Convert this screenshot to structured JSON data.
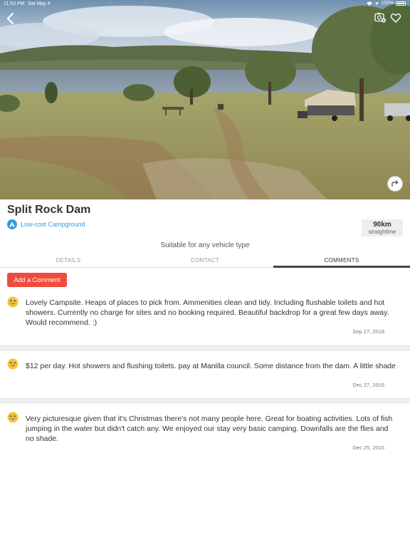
{
  "status_bar": {
    "time": "11:53 PM",
    "date": "Sat May 4",
    "battery": "100%"
  },
  "place": {
    "title": "Split Rock Dam",
    "type_label": "Low-cost Campground",
    "distance_value": "90km",
    "distance_unit": "straightline",
    "suitability": "Suitable for any vehicle type"
  },
  "tabs": [
    {
      "label": "DETAILS",
      "active": false
    },
    {
      "label": "CONTACT",
      "active": false
    },
    {
      "label": "COMMENTS",
      "active": true
    }
  ],
  "add_comment_label": "Add a Comment",
  "comments": [
    {
      "text": "Lovely Campsite. Heaps of places to pick from. Ammenities clean and tidy. Including flushable toilets and hot showers. Currently no charge for sites and no booking required. Beautiful backdrop for a great few days away. Would recommend. :)",
      "date": "Sep 27, 2018",
      "icon": "smiley-icon"
    },
    {
      "text": "$12 per day. Hot showers and flushing toilets. pay at Manilla council. Some distance from the dam. A little shade",
      "date": "Dec 27, 2016",
      "icon": "smiley-icon"
    },
    {
      "text": "Very picturesque given that it's Christmas there's not many people here. Great for boating activities. Lots of fish jumping  in the water but didn't catch any.  We enjoyed our stay very basic camping. Downfalls are the flies and no shade.",
      "date": "Dec 25, 2016",
      "icon": "smiley-icon"
    }
  ],
  "icons": {
    "back": "chevron-left-icon",
    "photo": "add-photo-icon",
    "favorite": "heart-icon",
    "share": "share-icon",
    "type": "campground-icon"
  },
  "colors": {
    "accent_blue": "#2f9ee0",
    "add_button": "#ef4b3c",
    "tab_underline": "#444444"
  }
}
